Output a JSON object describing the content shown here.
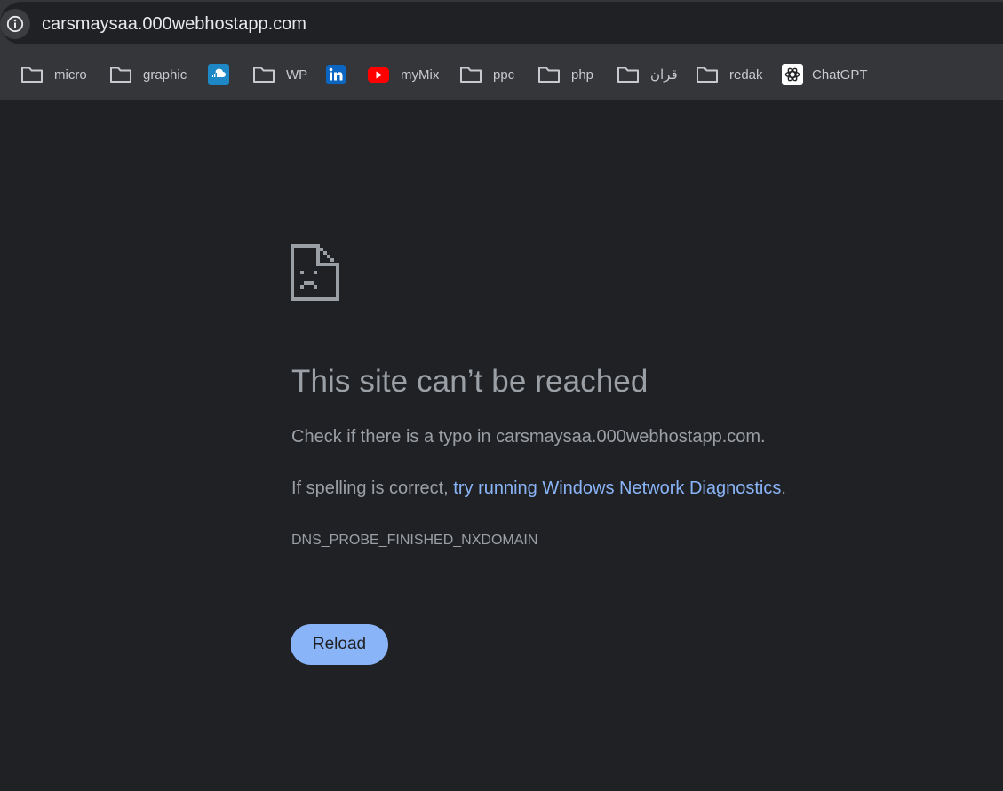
{
  "address_bar": {
    "url": "carsmaysaa.000webhostapp.com",
    "site_info_icon": "info-icon"
  },
  "bookmarks": [
    {
      "label": "micro",
      "icon": "folder-icon"
    },
    {
      "label": "graphic",
      "icon": "folder-icon"
    },
    {
      "label": "",
      "icon": "soundcloud-icon"
    },
    {
      "label": "WP",
      "icon": "folder-icon"
    },
    {
      "label": "",
      "icon": "linkedin-icon"
    },
    {
      "label": "myMix",
      "icon": "youtube-icon"
    },
    {
      "label": "ppc",
      "icon": "folder-icon"
    },
    {
      "label": "php",
      "icon": "folder-icon"
    },
    {
      "label": "قران",
      "icon": "folder-icon"
    },
    {
      "label": "redak",
      "icon": "folder-icon"
    },
    {
      "label": "ChatGPT",
      "icon": "chatgpt-icon"
    }
  ],
  "error_page": {
    "icon": "sad-page-icon",
    "title": "This site can’t be reached",
    "check_text": "Check if there is a typo in carsmaysaa.000webhostapp.com.",
    "spelling_prefix": "If spelling is correct, ",
    "diagnostics_link": "try running Windows Network Diagnostics",
    "spelling_suffix": ".",
    "error_code": "DNS_PROBE_FINISHED_NXDOMAIN",
    "reload_label": "Reload"
  },
  "colors": {
    "page_background": "#202124",
    "toolbar_background": "#35363a",
    "text_secondary": "#9aa0a6",
    "link": "#8ab4f8",
    "button_background": "#8ab4f8",
    "youtube_red": "#ff0000",
    "linkedin_blue": "#0a66c2",
    "soundcloud_tile": "#1e88c7"
  }
}
